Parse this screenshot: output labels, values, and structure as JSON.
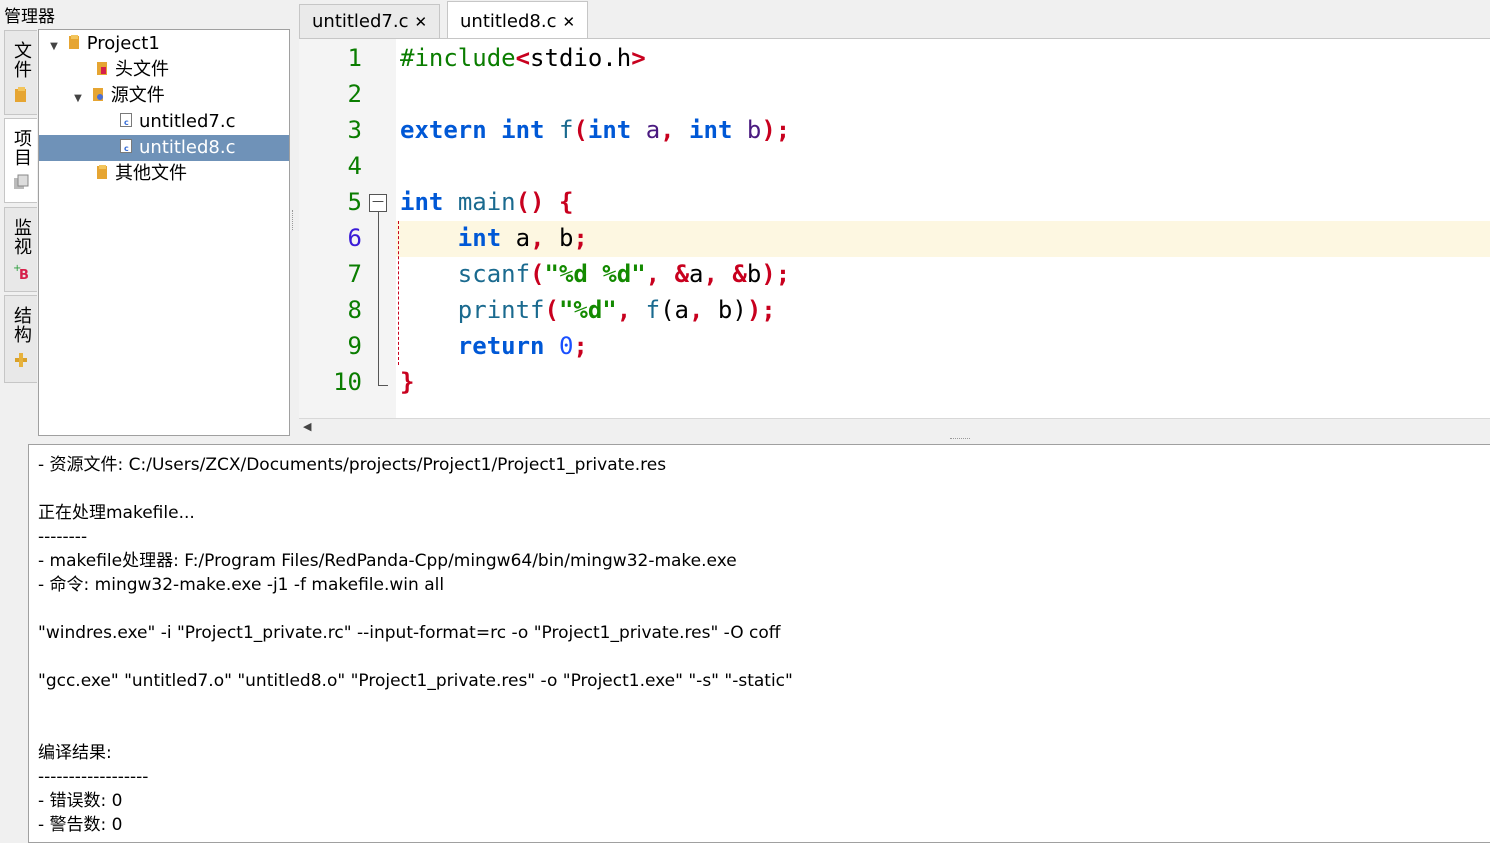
{
  "manager": {
    "title": "管理器"
  },
  "side_tabs": [
    {
      "label": "文件",
      "icon": "folder-icon"
    },
    {
      "label": "项目",
      "icon": "project-icon"
    },
    {
      "label": "监视",
      "icon": "watch-icon"
    },
    {
      "label": "结构",
      "icon": "structure-icon"
    }
  ],
  "tree": {
    "project": "Project1",
    "headers": "头文件",
    "sources": "源文件",
    "file1": "untitled7.c",
    "file2": "untitled8.c",
    "others": "其他文件"
  },
  "editor_tabs": [
    {
      "label": "untitled7.c",
      "close": "✕"
    },
    {
      "label": "untitled8.c",
      "close": "✕"
    }
  ],
  "line_numbers": [
    "1",
    "2",
    "3",
    "4",
    "5",
    "6",
    "7",
    "8",
    "9",
    "10"
  ],
  "fold_marker": "—",
  "log": [
    "- 资源文件: C:/Users/ZCX/Documents/projects/Project1/Project1_private.res",
    "",
    "正在处理makefile...",
    "--------",
    "- makefile处理器: F:/Program Files/RedPanda-Cpp/mingw64/bin/mingw32-make.exe",
    "- 命令: mingw32-make.exe -j1 -f makefile.win all",
    "",
    "\"windres.exe\" -i \"Project1_private.rc\" --input-format=rc -o \"Project1_private.res\" -O coff",
    "",
    "\"gcc.exe\" \"untitled7.o\" \"untitled8.o\" \"Project1_private.res\" -o \"Project1.exe\" \"-s\" \"-static\"",
    "",
    "",
    "编译结果:",
    "------------------",
    "- 错误数: 0",
    "- 警告数: 0"
  ],
  "colors": {
    "keyword": "#0058d6",
    "punct": "#c8001e",
    "string": "#138a00",
    "line_number": "#0a7d00",
    "selection": "#6f92b8",
    "current_line": "#fdf7e1"
  }
}
